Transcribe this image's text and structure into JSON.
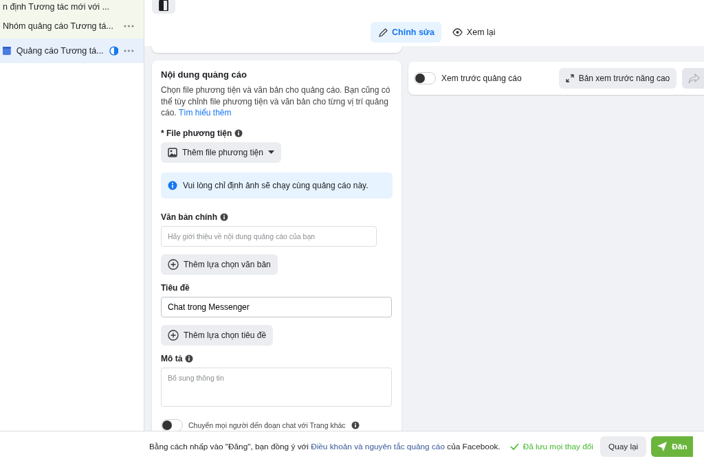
{
  "sidebar": {
    "items": [
      {
        "label": "n định Tương tác mới với ...",
        "kind": "campaign",
        "selected": false
      },
      {
        "label": "Nhóm quảng cáo Tương tá...",
        "kind": "adset",
        "selected": false
      },
      {
        "label": "Quảng cáo Tương tá...",
        "kind": "ad",
        "selected": true
      }
    ]
  },
  "mode_tabs": [
    {
      "label": "Chỉnh sửa",
      "kind": "edit",
      "selected": true
    },
    {
      "label": "Xem lại",
      "kind": "review",
      "selected": false
    }
  ],
  "ad_content": {
    "title": "Nội dung quảng cáo",
    "description": "Chọn file phương tiện và văn bản cho quảng cáo. Bạn cũng có thể tùy chỉnh file phương tiện và văn bản cho từng vị trí quảng cáo.",
    "learn_more": "Tìm hiểu thêm",
    "media": {
      "label": "* File phương tiện",
      "button": "Thêm file phương tiện"
    },
    "notice": "Vui lòng chỉ định ảnh sẽ chạy cùng quảng cáo này.",
    "primary_text": {
      "label": "Văn bản chính",
      "placeholder": "Hãy giới thiệu về nội dung quảng cáo của bạn",
      "add_button": "Thêm lựa chọn văn bản"
    },
    "headline": {
      "label": "Tiêu đề",
      "value": "Chat trong Messenger",
      "add_button": "Thêm lựa chọn tiêu đề"
    },
    "description_field": {
      "label": "Mô tả",
      "placeholder": "Bổ sung thông tin"
    },
    "redirect_toggle": {
      "label": "Chuyển mọi người đến đoạn chat với Trang khác",
      "on": false
    }
  },
  "preview": {
    "toggle": {
      "label": "Xem trước quảng cáo",
      "on": false
    },
    "advanced_button": "Bản xem trước nâng cao",
    "share_disabled": true
  },
  "footer": {
    "consent_before": "Bằng cách nhấp vào \"Đăng\", bạn đồng ý với ",
    "consent_link": "Điều khoản và nguyên tắc quảng cáo",
    "consent_after": " của Facebook.",
    "saved": "Đã lưu mọi thay đổi",
    "back_button": "Quay lại",
    "publish_button": "Đăn"
  }
}
